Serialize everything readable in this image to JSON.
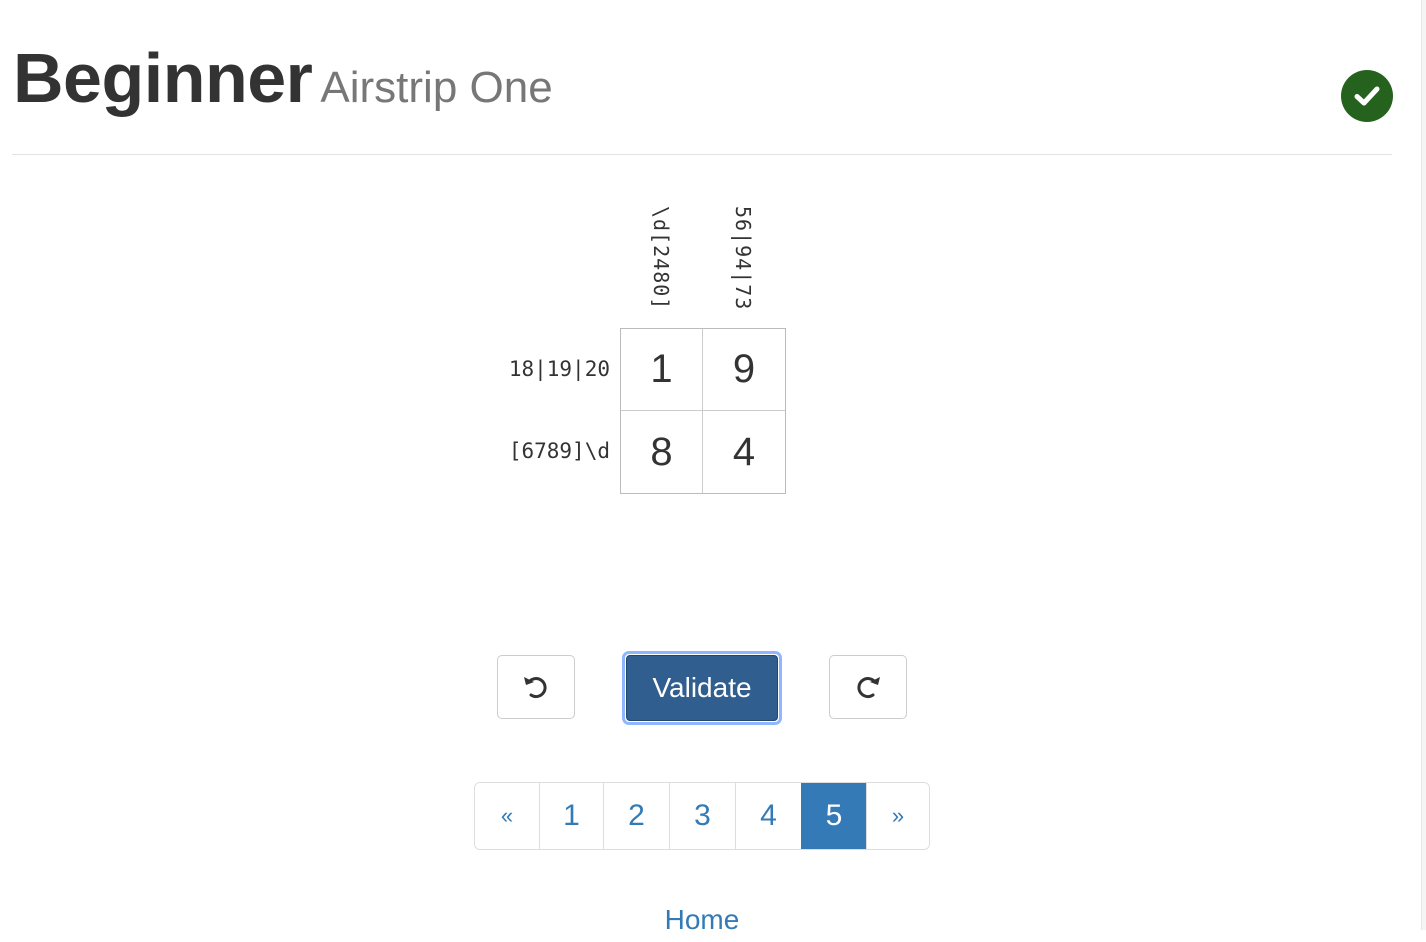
{
  "header": {
    "title": "Beginner",
    "subtitle": "Airstrip One",
    "status_color": "#25621d",
    "status_icon": "check-icon"
  },
  "puzzle": {
    "column_clues": [
      "\\d[2480]",
      "56|94|73"
    ],
    "row_clues": [
      "18|19|20",
      "[6789]\\d"
    ],
    "cells": [
      [
        "1",
        "9"
      ],
      [
        "8",
        "4"
      ]
    ]
  },
  "controls": {
    "undo_icon": "undo-icon",
    "validate_label": "Validate",
    "redo_icon": "redo-icon",
    "validate_color": "#2f5e8f"
  },
  "pagination": {
    "prev_label": "«",
    "pages": [
      "1",
      "2",
      "3",
      "4",
      "5"
    ],
    "current_page": "5",
    "next_label": "»",
    "active_color": "#337ab7"
  },
  "footer": {
    "home_label": "Home"
  }
}
